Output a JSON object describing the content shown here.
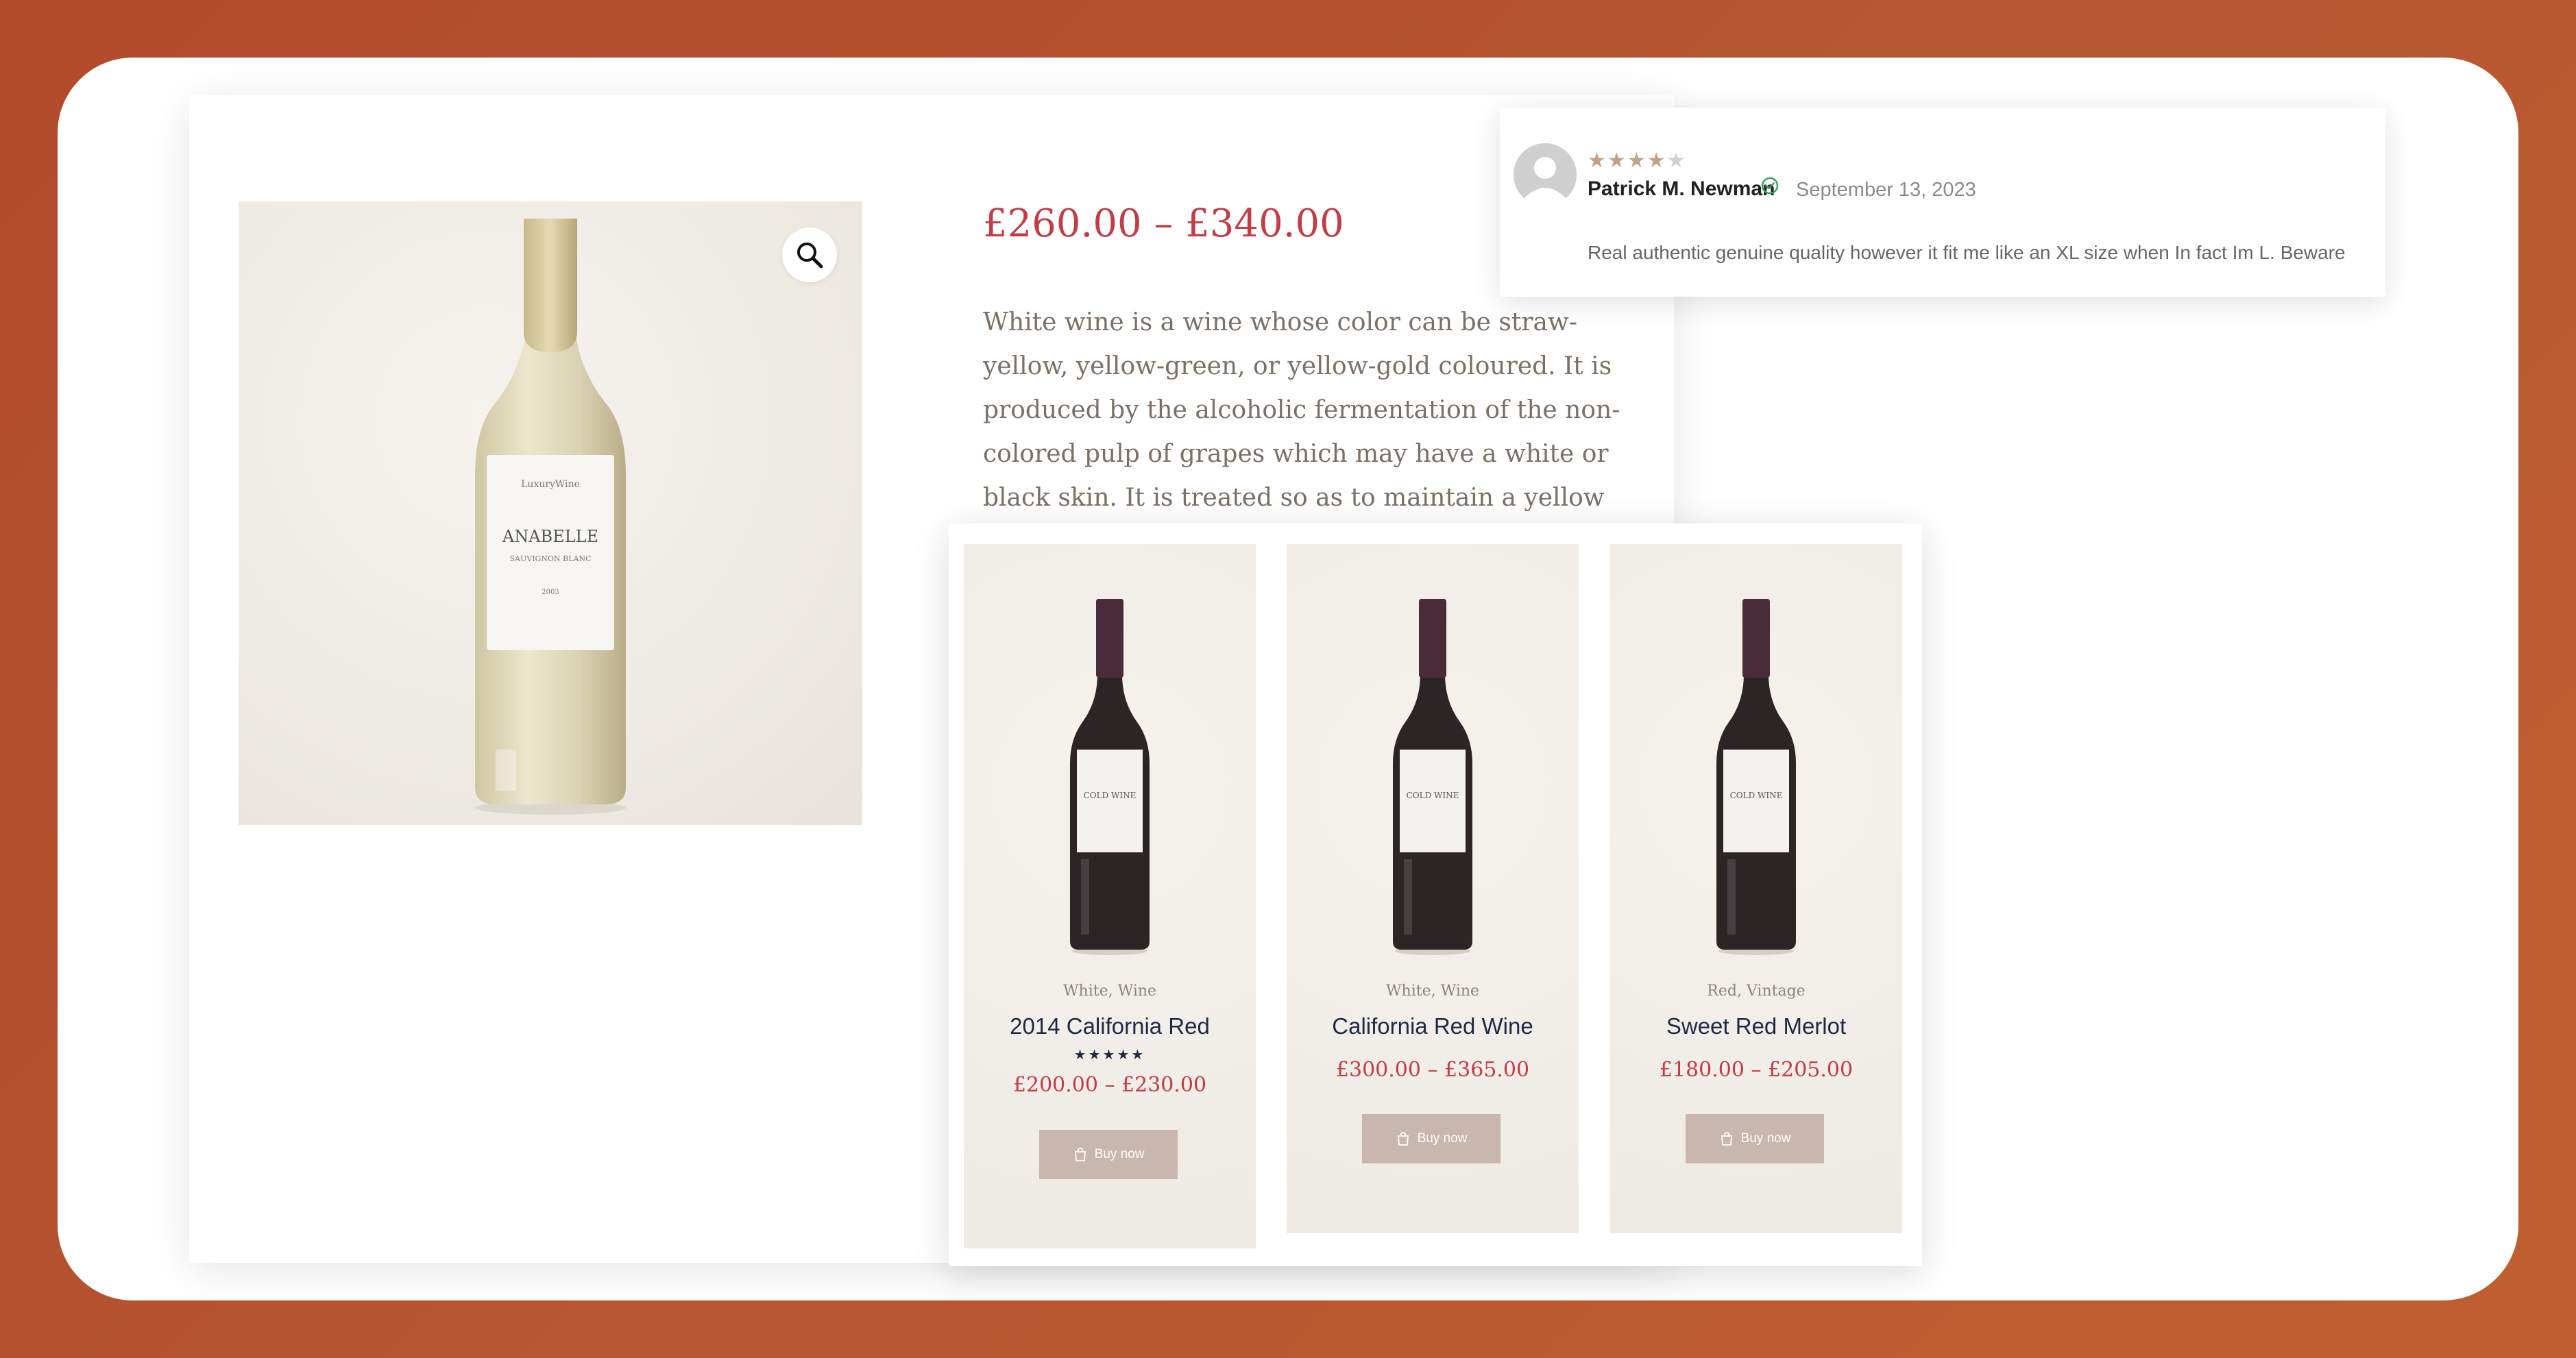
{
  "product": {
    "price_range": "£260.00 – £340.00",
    "description": "White wine is a wine whose color can be straw-yellow, yellow-green, or yellow-gold coloured. It is produced by the alcoholic fermentation of the non-colored pulp of grapes which may have a white or black skin. It is treated so as to maintain a yellow transparent color.",
    "bottle_label": {
      "brand": "LuxuryWine",
      "name": "ANABELLE",
      "subtitle": "SAUVIGNON BLANC",
      "year": "2003"
    },
    "zoom_icon": "magnifier-icon"
  },
  "review": {
    "rating": 4,
    "max_rating": 5,
    "reviewer": "Patrick M. Newman",
    "date": "September 13, 2023",
    "text": "Real authentic genuine quality however it fit me like an XL size when In fact Im L. Beware",
    "verified_icon": "check-circle-icon",
    "star_color": "#bfa384"
  },
  "related": [
    {
      "categories": "White, Wine",
      "name": "2014 California Red",
      "rating_stars": "★★★★★",
      "price": "£200.00 – £230.00",
      "button": "Buy now",
      "label": "COLD WINE"
    },
    {
      "categories": "White, Wine",
      "name": "California Red Wine",
      "price": "£300.00 – £365.00",
      "button": "Buy now",
      "label": "COLD WINE"
    },
    {
      "categories": "Red, Vintage",
      "name": "Sweet Red Merlot",
      "price": "£180.00 – £205.00",
      "button": "Buy now",
      "label": "COLD WINE"
    }
  ],
  "colors": {
    "background": "#b14a2b",
    "price": "#c23d46",
    "title": "#1e2a44",
    "button": "#c9b6ae"
  }
}
